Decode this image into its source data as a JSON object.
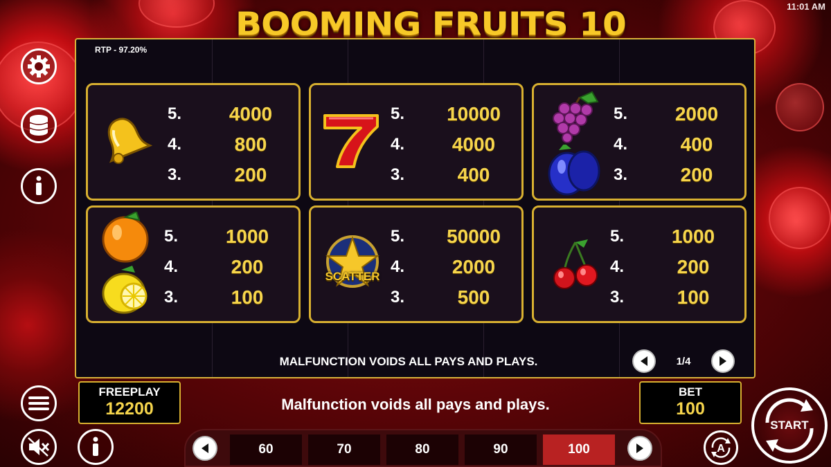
{
  "status_bar": {
    "time": "11:01 AM"
  },
  "game": {
    "title": "BOOMING FRUITS 10",
    "rtp": "RTP - 97.20%"
  },
  "paytable": [
    {
      "symbol": "bell-icon",
      "rows": [
        {
          "count": "5.",
          "payout": "4000"
        },
        {
          "count": "4.",
          "payout": "800"
        },
        {
          "count": "3.",
          "payout": "200"
        }
      ]
    },
    {
      "symbol": "seven-icon",
      "rows": [
        {
          "count": "5.",
          "payout": "10000"
        },
        {
          "count": "4.",
          "payout": "4000"
        },
        {
          "count": "3.",
          "payout": "400"
        }
      ]
    },
    {
      "symbol": "grapes-plum-icon",
      "rows": [
        {
          "count": "5.",
          "payout": "2000"
        },
        {
          "count": "4.",
          "payout": "400"
        },
        {
          "count": "3.",
          "payout": "200"
        }
      ]
    },
    {
      "symbol": "orange-lemon-icon",
      "rows": [
        {
          "count": "5.",
          "payout": "1000"
        },
        {
          "count": "4.",
          "payout": "200"
        },
        {
          "count": "3.",
          "payout": "100"
        }
      ]
    },
    {
      "symbol": "scatter-star-icon",
      "label": "SCATTER",
      "rows": [
        {
          "count": "5.",
          "payout": "50000"
        },
        {
          "count": "4.",
          "payout": "2000"
        },
        {
          "count": "3.",
          "payout": "500"
        }
      ]
    },
    {
      "symbol": "cherries-icon",
      "rows": [
        {
          "count": "5.",
          "payout": "1000"
        },
        {
          "count": "4.",
          "payout": "200"
        },
        {
          "count": "3.",
          "payout": "100"
        }
      ]
    }
  ],
  "board_footer": "MALFUNCTION VOIDS ALL PAYS AND PLAYS.",
  "pager": {
    "label": "1/4"
  },
  "freeplay": {
    "caption": "FREEPLAY",
    "value": "12200"
  },
  "bet": {
    "caption": "BET",
    "value": "100"
  },
  "message": "Malfunction voids all pays and plays.",
  "bet_options": [
    "60",
    "70",
    "80",
    "90",
    "100"
  ],
  "selected_bet": "100",
  "start_label": "START",
  "colors": {
    "gold": "#f6d54c",
    "border": "#d8b030",
    "selected_bet": "#b82222"
  }
}
